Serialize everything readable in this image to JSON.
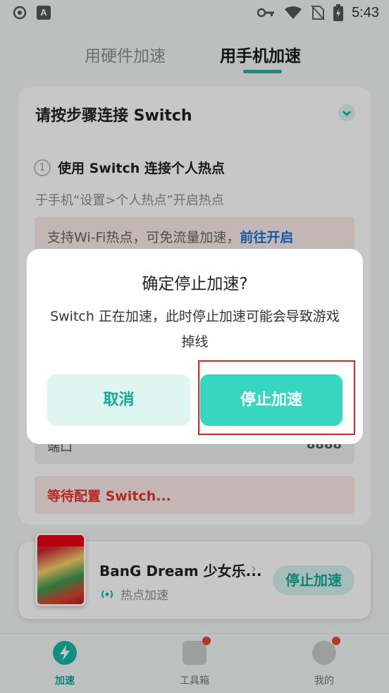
{
  "status_bar": {
    "time": "5:43",
    "left_icons": [
      "sync-icon",
      "a-badge-icon"
    ],
    "right_icons": [
      "key-icon",
      "wifi-icon",
      "no-sim-icon",
      "battery-icon"
    ],
    "a_badge": "A"
  },
  "tabs": [
    {
      "label": "用硬件加速",
      "active": false
    },
    {
      "label": "用手机加速",
      "active": true
    }
  ],
  "card": {
    "title": "请按步骤连接 Switch",
    "step": {
      "number": "1",
      "label": "使用 Switch 连接个人热点"
    },
    "hint": "于手机“设置>个人热点”开启热点",
    "wifi_notice": "支持Wi-Fi热点，可免流量加速，",
    "wifi_link": "前往开启",
    "port_label": "端口",
    "port_value": "8888",
    "waiting": "等待配置 Switch..."
  },
  "game_bar": {
    "title": "BanG Dream 少女乐...",
    "mode": "热点加速",
    "stop_label": "停止加速"
  },
  "bottom_nav": [
    {
      "label": "加速",
      "active": true,
      "icon": "lightning-icon"
    },
    {
      "label": "工具箱",
      "active": false,
      "icon": "toolbox-icon",
      "badge": true
    },
    {
      "label": "我的",
      "active": false,
      "icon": "face-icon",
      "badge": true
    }
  ],
  "dialog": {
    "title": "确定停止加速?",
    "message": "Switch 正在加速，此时停止加速可能会导致游戏掉线",
    "cancel_label": "取消",
    "confirm_label": "停止加速"
  },
  "colors": {
    "accent": "#17b8a6",
    "confirm_button": "#36d6c0",
    "cancel_button": "#dff5f2",
    "warning_text": "#e2362e",
    "link": "#1877d6",
    "highlight": "#e02424"
  }
}
